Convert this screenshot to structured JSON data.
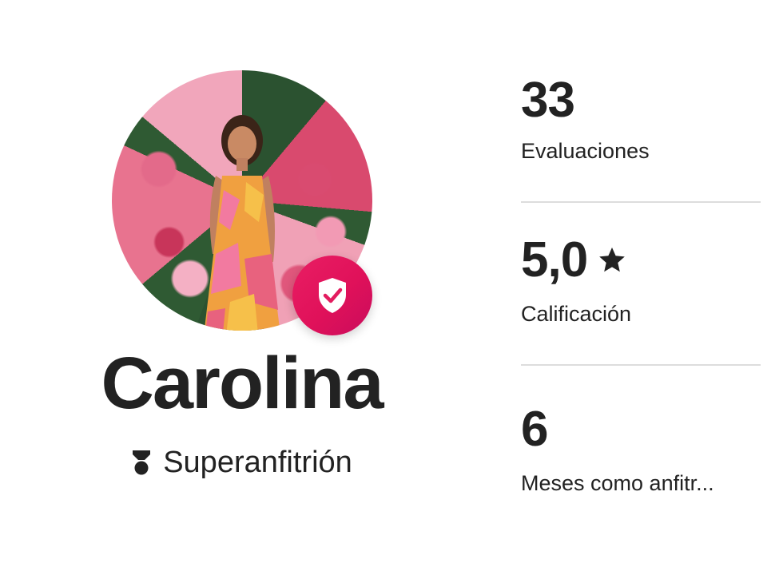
{
  "profile": {
    "name": "Carolina",
    "badge": "Superanfitrión",
    "verified_icon": "shield-check-icon",
    "superhost_icon": "superhost-medal-icon",
    "accent_color": "#E31C5F"
  },
  "stats": [
    {
      "value": "33",
      "label": "Evaluaciones"
    },
    {
      "value": "5,0",
      "label": "Calificación",
      "icon": "star-icon"
    },
    {
      "value": "6",
      "label": "Meses como anfitr..."
    }
  ]
}
